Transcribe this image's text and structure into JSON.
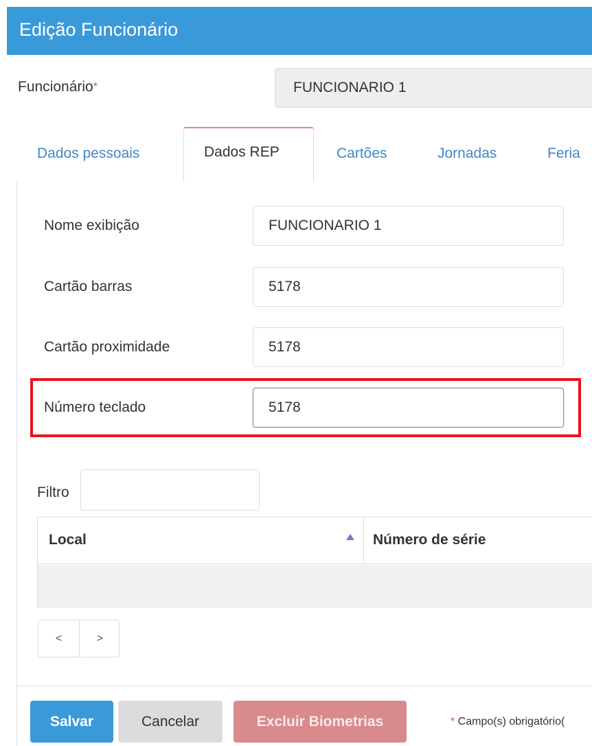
{
  "header": {
    "title": "Edição Funcionário"
  },
  "employee": {
    "label": "Funcionário",
    "required_mark": "*",
    "value": "FUNCIONARIO 1"
  },
  "tabs": [
    {
      "label": "Dados pessoais",
      "active": false
    },
    {
      "label": "Dados REP",
      "active": true
    },
    {
      "label": "Cartões",
      "active": false
    },
    {
      "label": "Jornadas",
      "active": false
    },
    {
      "label": "Feria",
      "active": false
    }
  ],
  "form": {
    "display_name": {
      "label": "Nome exibição",
      "value": "FUNCIONARIO 1"
    },
    "barcode_card": {
      "label": "Cartão barras",
      "value": "5178"
    },
    "proximity_card": {
      "label": "Cartão proximidade",
      "value": "5178"
    },
    "keypad_number": {
      "label": "Número teclado",
      "value": "5178"
    }
  },
  "filter": {
    "label": "Filtro",
    "value": ""
  },
  "grid": {
    "columns": [
      {
        "label": "Local",
        "sort": "ascending"
      },
      {
        "label": "Número de série"
      }
    ],
    "rows": []
  },
  "pager": {
    "prev_label": "<",
    "next_label": ">"
  },
  "footer": {
    "save_label": "Salvar",
    "cancel_label": "Cancelar",
    "delete_biometrics_label": "Excluir Biometrias",
    "required_note": "* Campo(s) obrigatório("
  },
  "colors": {
    "header": "#3a9ad9",
    "tab_link": "#3f87c8",
    "active_tab_top": "#e4888a",
    "highlight": "#e8121b",
    "save_button": "#3a9ad9",
    "delete_button": "#d88a8c",
    "required": "#d9534f"
  }
}
